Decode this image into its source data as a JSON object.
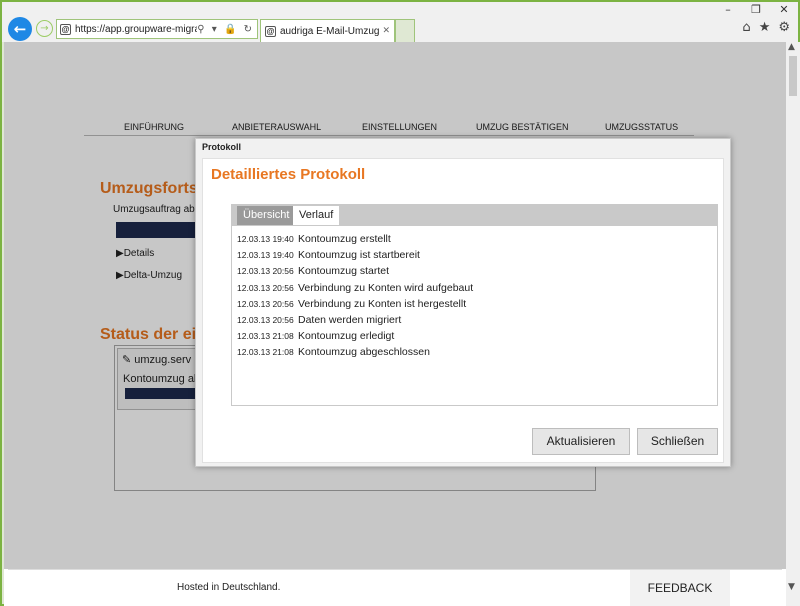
{
  "browser": {
    "url": "https://app.groupware-migration.com",
    "tab_title": "audriga E-Mail-Umzug",
    "window_controls": [
      "–",
      "❐",
      "✕"
    ],
    "address_icons": "⚲ ▾ 🔒 ↻",
    "toolbar_icons": [
      "home-icon",
      "star-icon",
      "gear-icon"
    ]
  },
  "page": {
    "nav_steps": [
      "EINFÜHRUNG",
      "ANBIETERAUSWAHL",
      "EINSTELLUNGEN",
      "UMZUG BESTÄTIGEN",
      "UMZUGSSTATUS"
    ],
    "progress_heading": "Umzugsforts",
    "progress_text": "Umzugsauftrag ab",
    "details_link": "Details",
    "delta_link": "Delta-Umzug",
    "status_heading": "Status der ei",
    "server_name": "umzug.serv",
    "server_status": "Kontoumzug abe"
  },
  "footer": {
    "hosted": "Hosted in Deutschland.",
    "feedback": "FEEDBACK"
  },
  "dialog": {
    "title": "Protokoll",
    "heading": "Detailliertes Protokoll",
    "tabs": [
      "Übersicht",
      "Verlauf"
    ],
    "active_tab": "Verlauf",
    "log": [
      {
        "ts": "12.03.13 19:40",
        "msg": "Kontoumzug erstellt"
      },
      {
        "ts": "12.03.13 19:40",
        "msg": "Kontoumzug ist startbereit"
      },
      {
        "ts": "12.03.13 20:56",
        "msg": "Kontoumzug startet"
      },
      {
        "ts": "12.03.13 20:56",
        "msg": "Verbindung zu Konten wird aufgebaut"
      },
      {
        "ts": "12.03.13 20:56",
        "msg": "Verbindung zu Konten ist hergestellt"
      },
      {
        "ts": "12.03.13 20:56",
        "msg": "Daten werden migriert"
      },
      {
        "ts": "12.03.13 21:08",
        "msg": "Kontoumzug erledigt"
      },
      {
        "ts": "12.03.13 21:08",
        "msg": "Kontoumzug abgeschlossen"
      }
    ],
    "refresh_label": "Aktualisieren",
    "close_label": "Schließen"
  },
  "colors": {
    "accent": "#e87722",
    "browser_green": "#8dc63f",
    "progress_bar": "#1d2a4d"
  }
}
